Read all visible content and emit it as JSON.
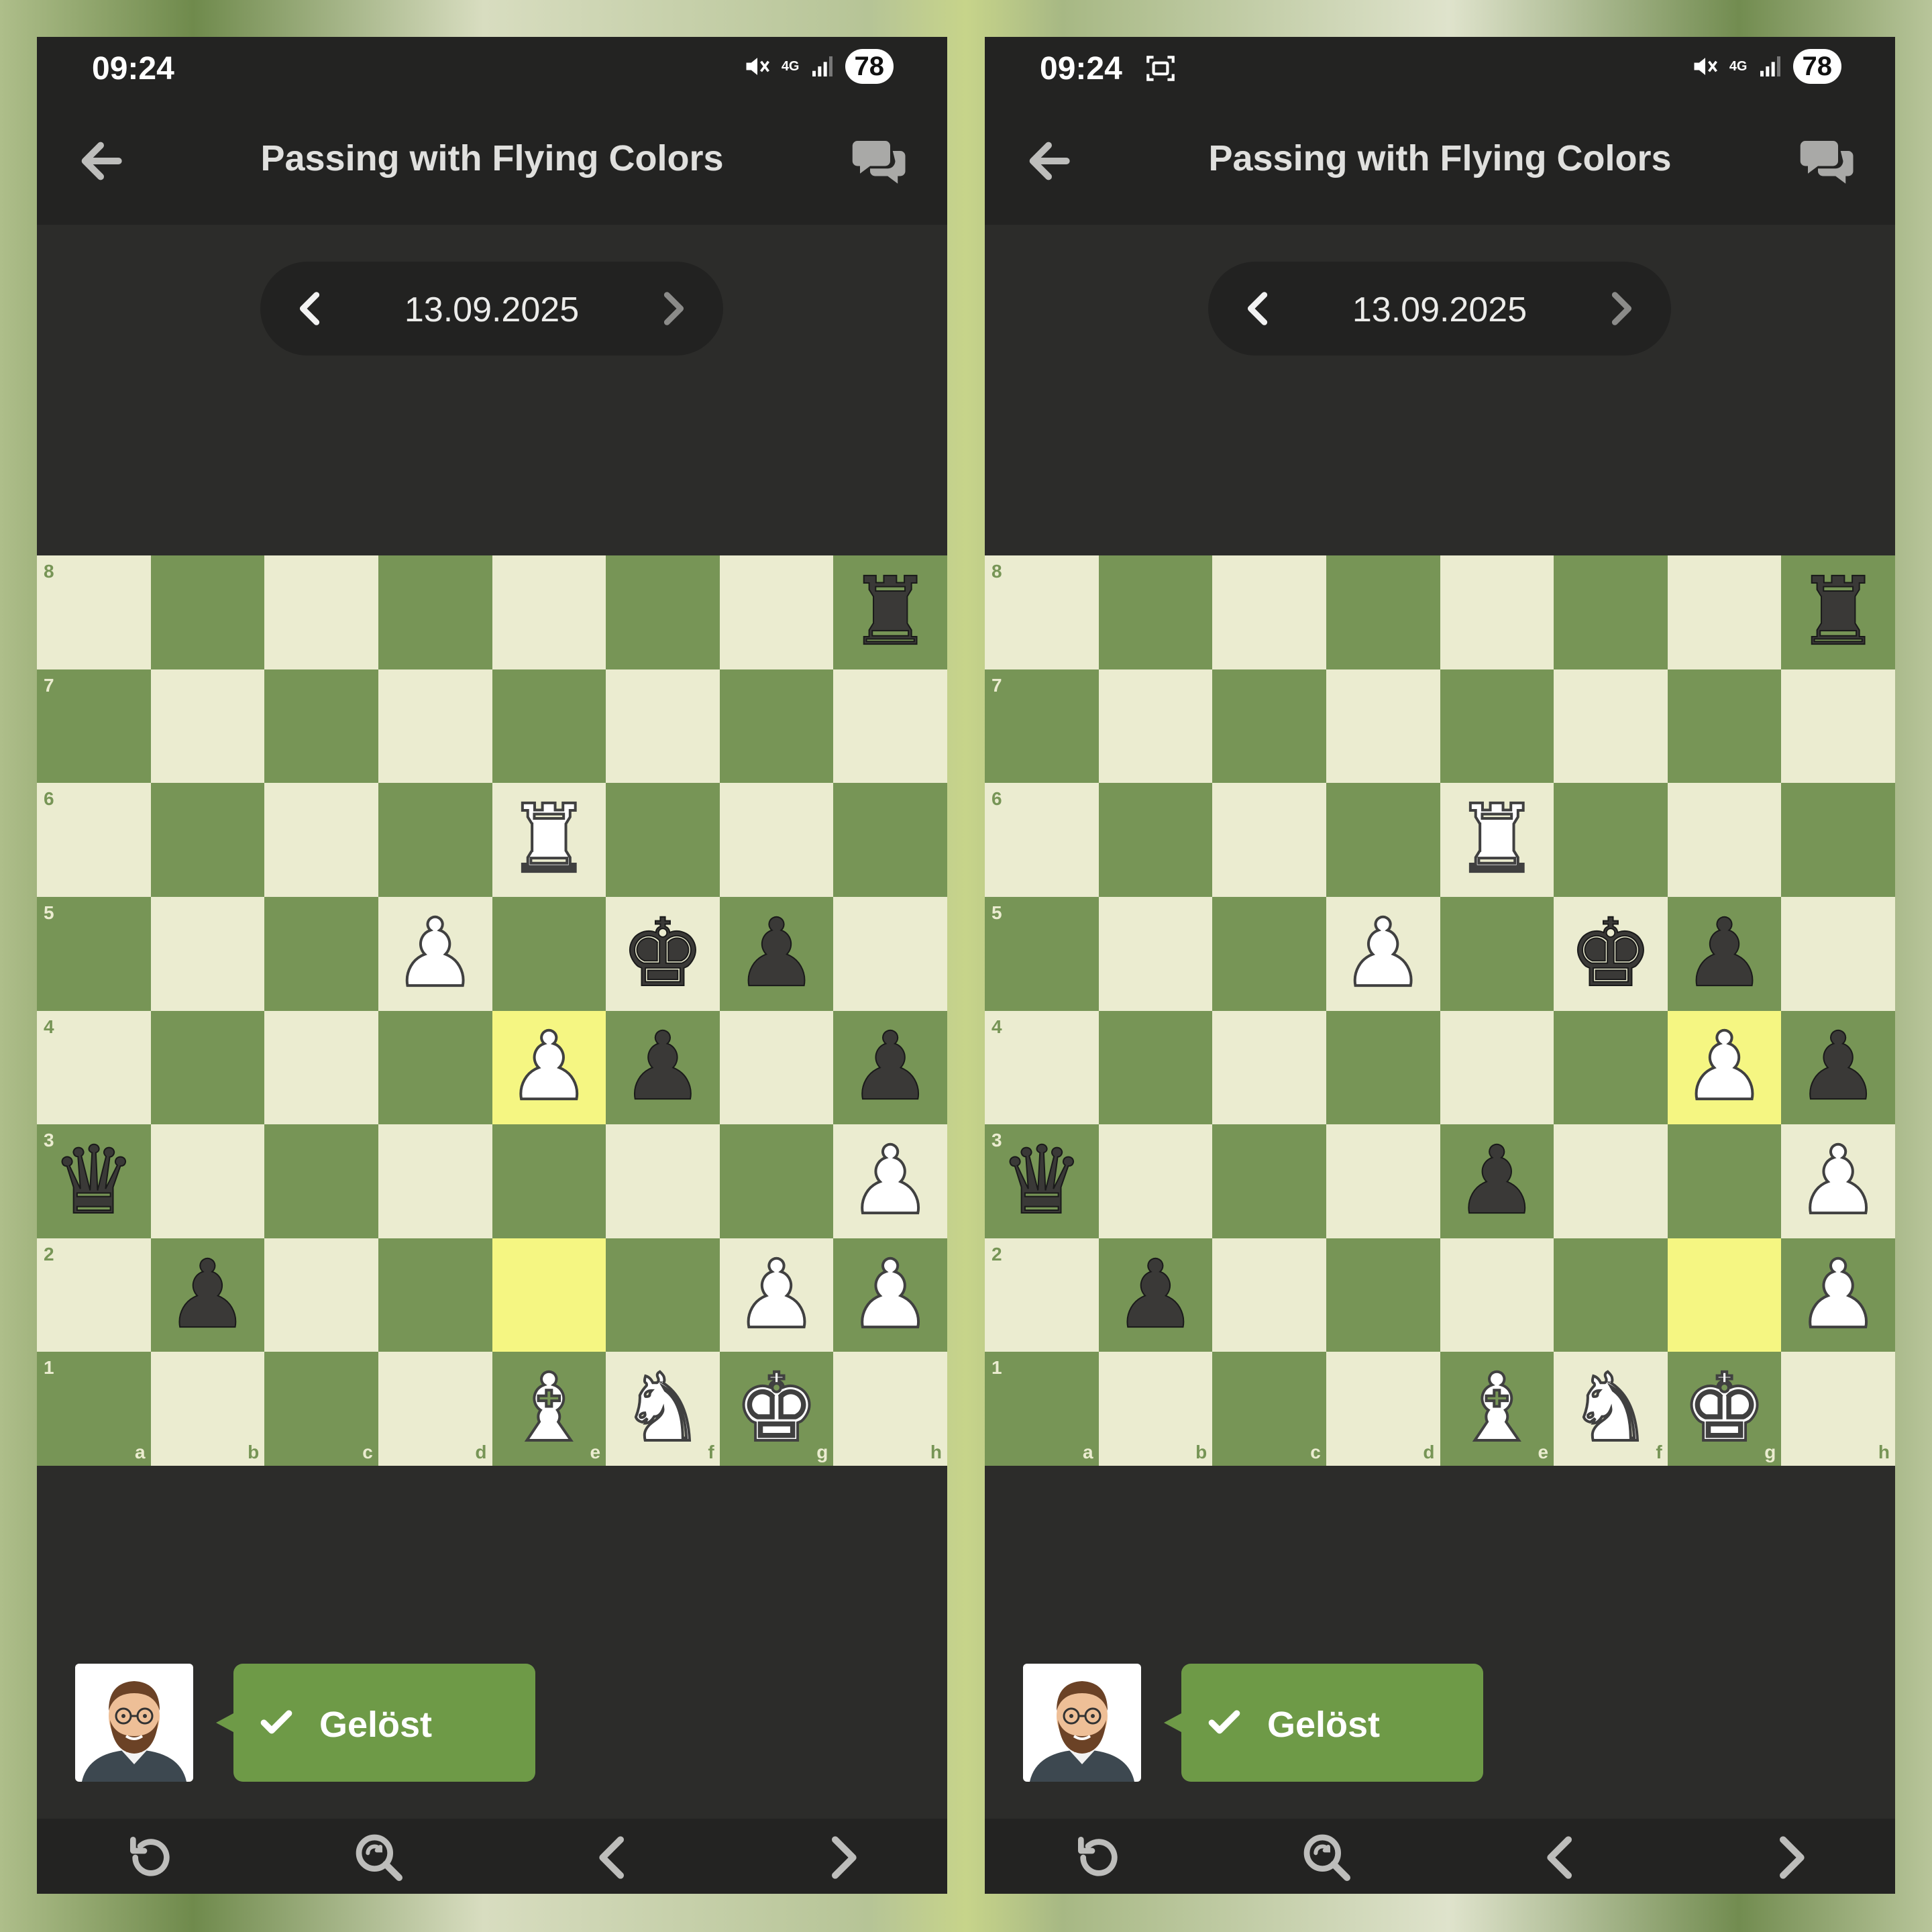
{
  "status_bar": {
    "time": "09:24",
    "network": "4G",
    "battery": "78"
  },
  "app_bar": {
    "title": "Passing with Flying Colors"
  },
  "date_nav": {
    "date": "13.09.2025"
  },
  "result": {
    "label": "Gelöst"
  },
  "board": {
    "files": [
      "a",
      "b",
      "c",
      "d",
      "e",
      "f",
      "g",
      "h"
    ],
    "ranks": [
      "8",
      "7",
      "6",
      "5",
      "4",
      "3",
      "2",
      "1"
    ],
    "colors": {
      "light": "#ebecd0",
      "dark": "#779556",
      "highlight": "#f5f682"
    }
  },
  "boards": [
    {
      "id": "left",
      "pieces": {
        "h8": "bR",
        "e6": "wR",
        "d5": "wP",
        "f5": "bK",
        "g5": "bP",
        "e4": "wP",
        "f4": "bP",
        "h4": "bP",
        "a3": "bQ",
        "h3": "wP",
        "b2": "bP",
        "g2": "wP",
        "h2": "wP",
        "e1": "wB",
        "f1": "wN",
        "g1": "wK"
      },
      "highlights": [
        "e4",
        "e2"
      ]
    },
    {
      "id": "right",
      "pieces": {
        "h8": "bR",
        "e6": "wR",
        "d5": "wP",
        "f5": "bK",
        "g5": "bP",
        "g4": "wP",
        "h4": "bP",
        "a3": "bQ",
        "e3": "bP",
        "h3": "wP",
        "b2": "bP",
        "h2": "wP",
        "e1": "wB",
        "f1": "wN",
        "g1": "wK"
      },
      "highlights": [
        "g4",
        "g2"
      ]
    }
  ],
  "bottom_bar": [
    "retry-icon",
    "zoom-icon",
    "chevron-left-icon",
    "chevron-right-icon"
  ],
  "accent_color": "#6e9a47"
}
